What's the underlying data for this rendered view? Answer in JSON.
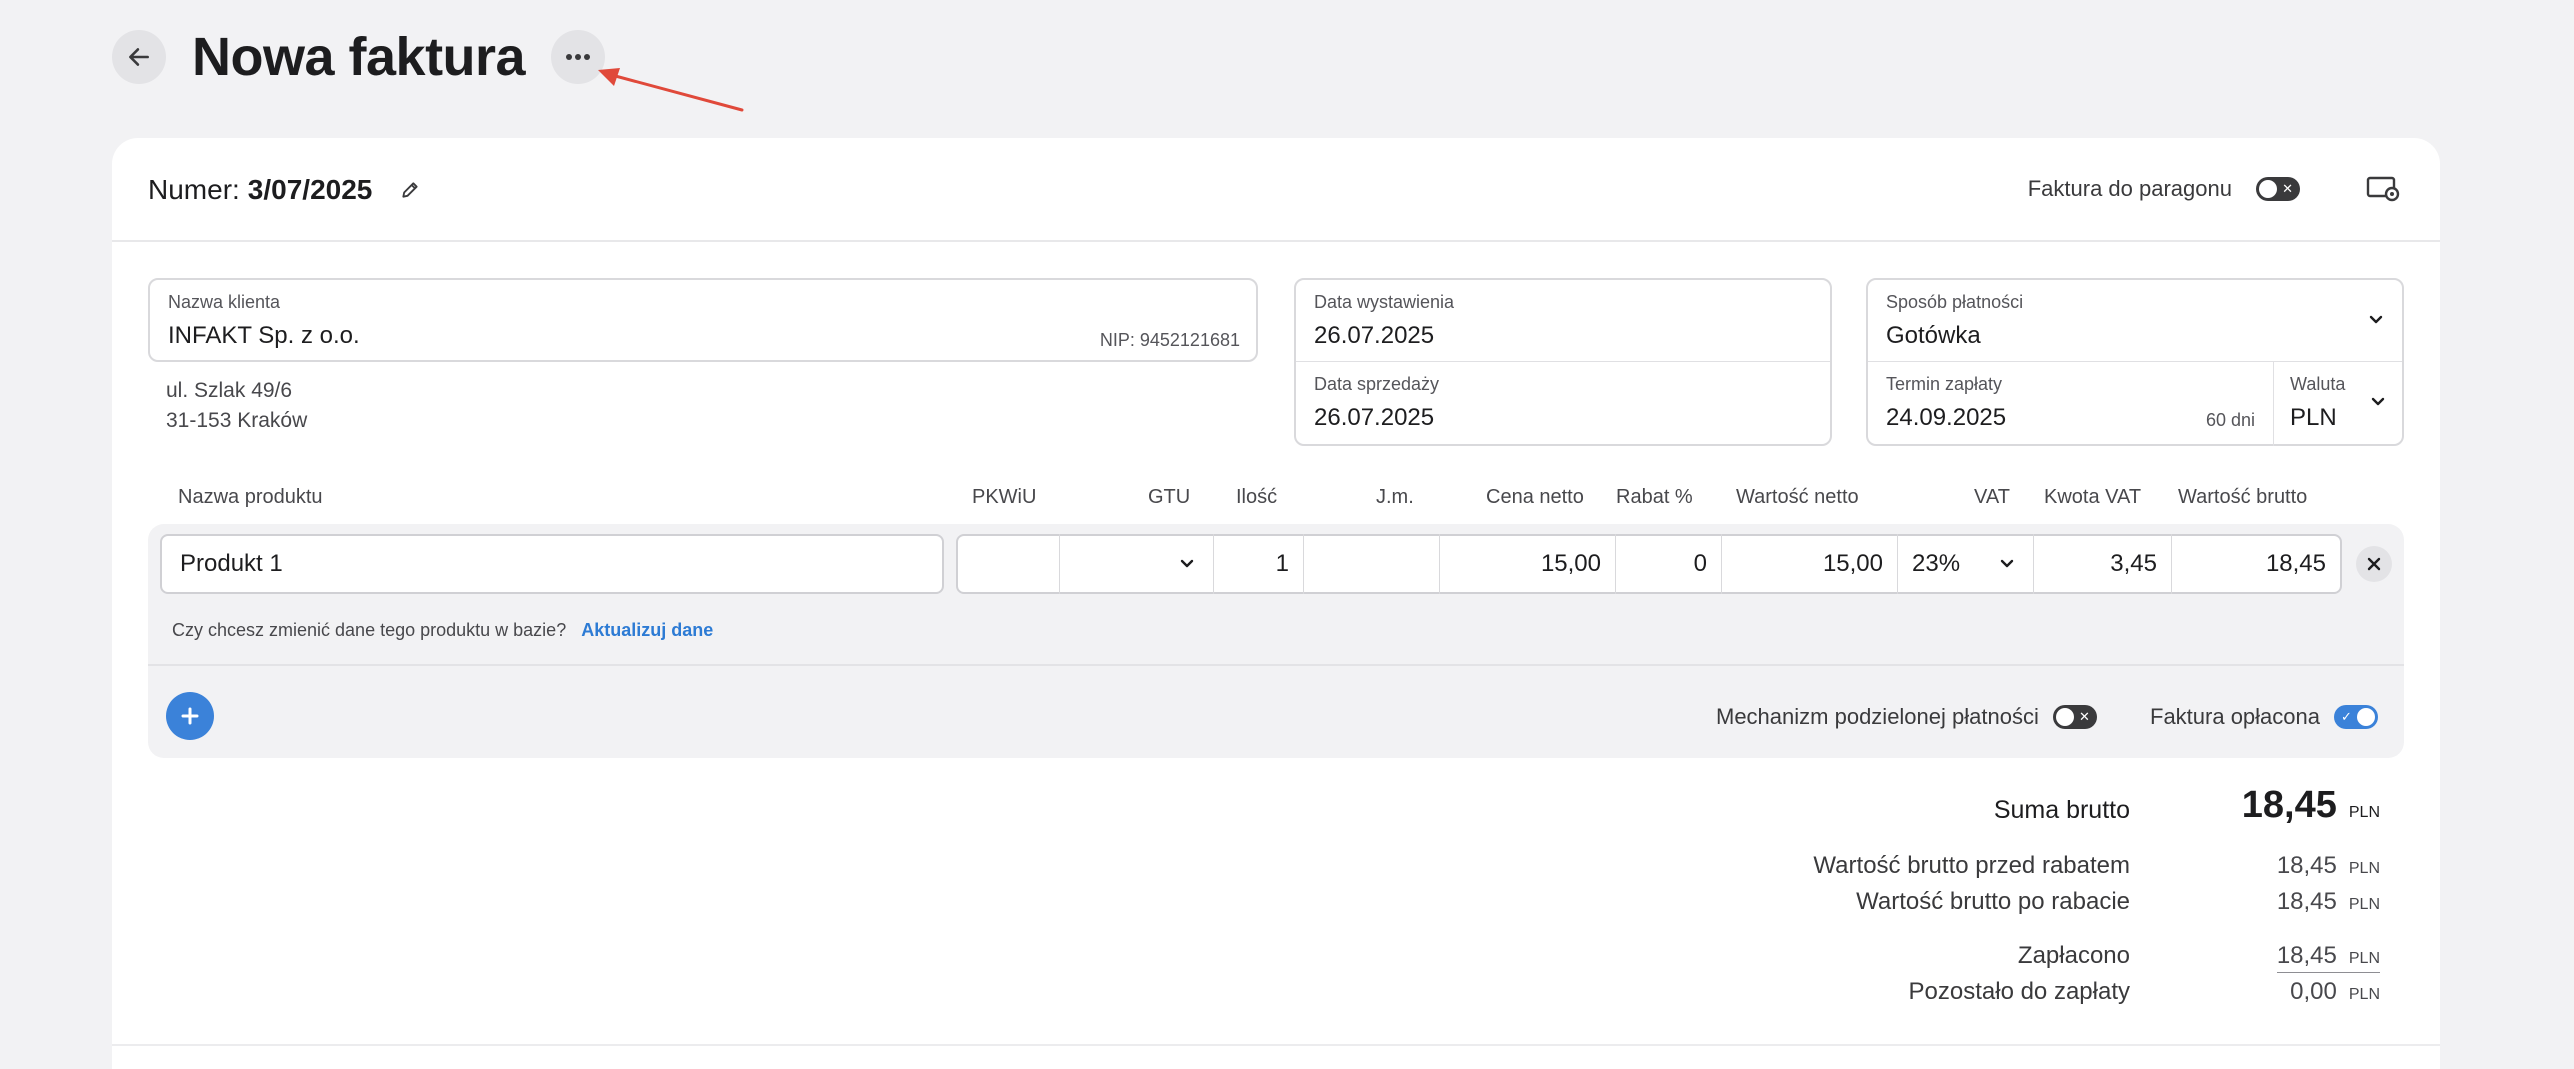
{
  "header": {
    "title": "Nowa faktura"
  },
  "invoice": {
    "number_label": "Numer:",
    "number": "3/07/2025",
    "receipt_toggle_label": "Faktura do paragonu",
    "receipt_toggle_on": false
  },
  "client": {
    "label": "Nazwa klienta",
    "name": "INFAKT Sp. z o.o.",
    "nip": "NIP: 9452121681",
    "address_line1": "ul. Szlak 49/6",
    "address_line2": "31-153 Kraków"
  },
  "dates": {
    "issue_label": "Data wystawienia",
    "issue_value": "26.07.2025",
    "sale_label": "Data sprzedaży",
    "sale_value": "26.07.2025"
  },
  "payment": {
    "method_label": "Sposób płatności",
    "method_value": "Gotówka",
    "due_label": "Termin zapłaty",
    "due_value": "24.09.2025",
    "due_days": "60 dni",
    "currency_label": "Waluta",
    "currency_value": "PLN"
  },
  "columns": {
    "name": "Nazwa produktu",
    "pkwiu": "PKWiU",
    "gtu": "GTU",
    "qty": "Ilość",
    "unit": "J.m.",
    "net_price": "Cena netto",
    "discount": "Rabat %",
    "net_value": "Wartość netto",
    "vat": "VAT",
    "vat_amount": "Kwota VAT",
    "gross_value": "Wartość brutto"
  },
  "product": {
    "name": "Produkt 1",
    "pkwiu": "",
    "gtu": "",
    "qty": "1",
    "unit": "",
    "net_price": "15,00",
    "discount": "0",
    "net_value": "15,00",
    "vat": "23%",
    "vat_amount": "3,45",
    "gross_value": "18,45"
  },
  "hint": {
    "text": "Czy chcesz zmienić dane tego produktu w bazie?",
    "link": "Aktualizuj dane"
  },
  "options": {
    "split_payment_label": "Mechanizm podzielonej płatności",
    "split_payment_on": false,
    "paid_label": "Faktura opłacona",
    "paid_on": true
  },
  "summary": {
    "currency": "PLN",
    "gross_label": "Suma brutto",
    "gross_value": "18,45",
    "before_discount_label": "Wartość brutto przed rabatem",
    "before_discount_value": "18,45",
    "after_discount_label": "Wartość brutto po rabacie",
    "after_discount_value": "18,45",
    "paid_label": "Zapłacono",
    "paid_value": "18,45",
    "remaining_label": "Pozostało do zapłaty",
    "remaining_value": "0,00"
  },
  "colors": {
    "accent": "#3b82d9",
    "annotation_arrow": "#e0493a"
  }
}
